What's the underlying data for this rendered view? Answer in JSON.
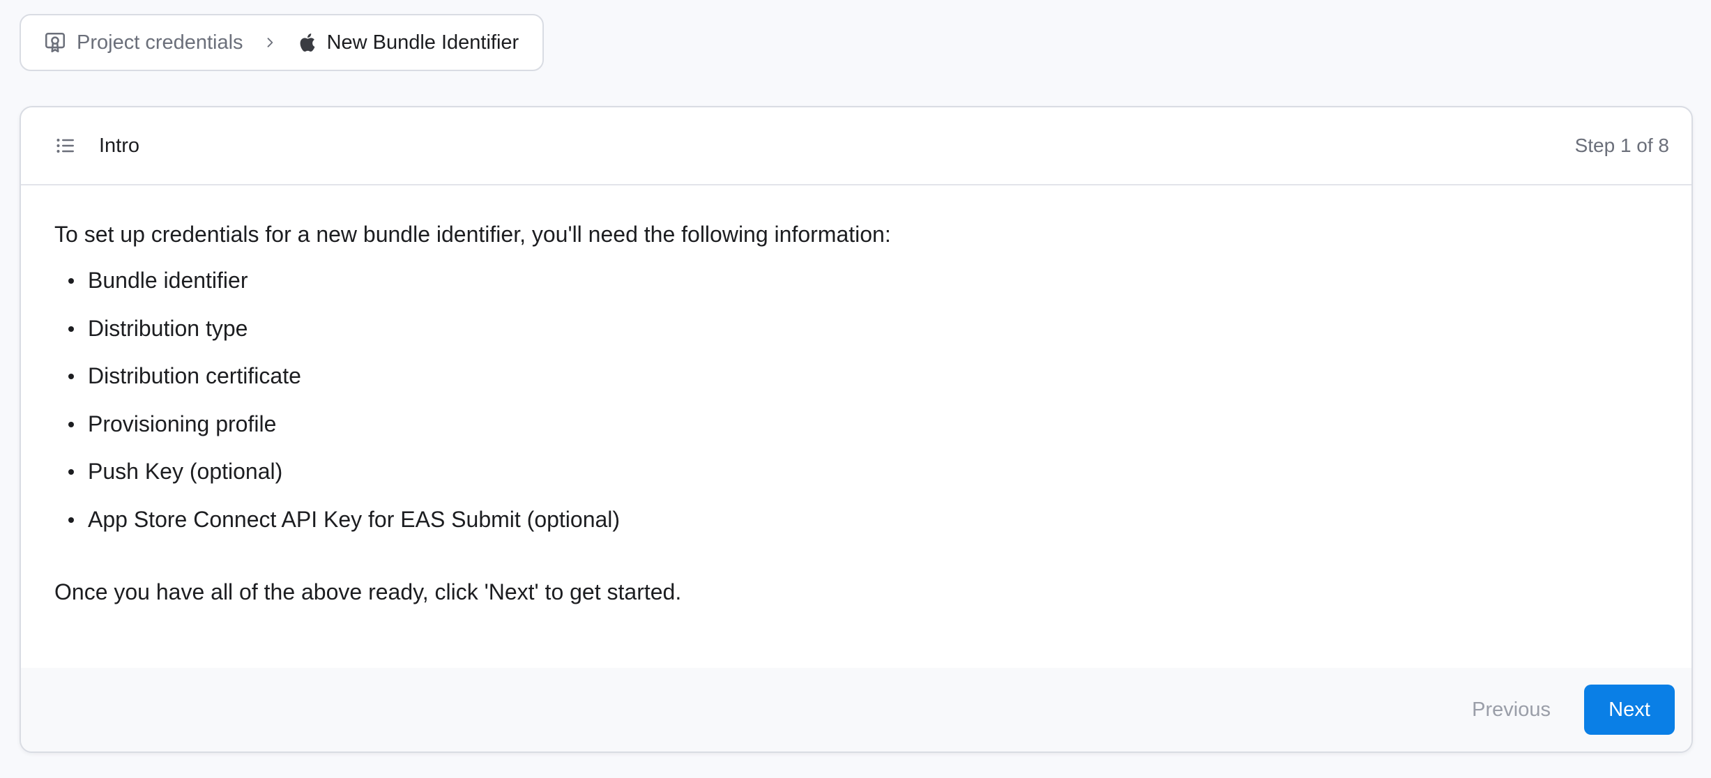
{
  "breadcrumb": {
    "root_label": "Project credentials",
    "root_icon": "certificate-icon",
    "separator_icon": "chevron-right-icon",
    "current_icon": "apple-icon",
    "current_label": "New Bundle Identifier"
  },
  "wizard": {
    "header_icon": "list-icon",
    "step_title": "Intro",
    "step_counter": "Step 1 of 8",
    "intro": "To set up credentials for a new bundle identifier, you'll need the following information:",
    "requirements": [
      "Bundle identifier",
      "Distribution type",
      "Distribution certificate",
      "Provisioning profile",
      "Push Key (optional)",
      "App Store Connect API Key for EAS Submit (optional)"
    ],
    "outro": "Once you have all of the above ready, click 'Next' to get started.",
    "previous_label": "Previous",
    "next_label": "Next"
  },
  "colors": {
    "accent": "#0a7fe6",
    "background": "#f8f9fc",
    "border": "#d9dce3",
    "muted_text": "#6b6f7a",
    "disabled_text": "#9a9ea8"
  }
}
